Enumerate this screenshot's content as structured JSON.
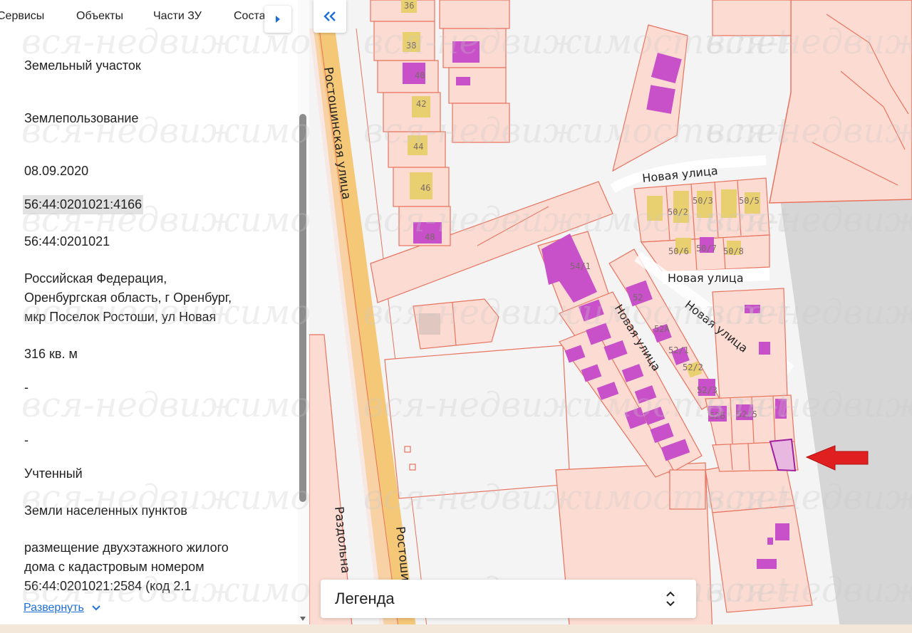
{
  "tabs": [
    "Сервисы",
    "Объекты",
    "Части ЗУ",
    "Соста"
  ],
  "fields": {
    "object_type": "Земельный участок",
    "group": "Землепользование",
    "date": "08.09.2020",
    "cadastral_number": "56:44:0201021:4166",
    "quarter": "56:44:0201021",
    "address_line1": "Российская Федерация,",
    "address_line2": "Оренбургская область, г Оренбург,",
    "address_line3": "мкр Поселок Ростоши, ул Новая",
    "area": "316 кв. м",
    "dash1": "-",
    "dash2": "-",
    "status": "Учтенный",
    "category": "Земли населенных пунктов",
    "use_line1": "размещение двухэтажного жилого",
    "use_line2": "дома с кадастровым номером",
    "use_line3": "56:44:0201021:2584 (код 2.1"
  },
  "expand_label": "Развернуть",
  "legend_label": "Легенда",
  "icons": {
    "tab_nav": "caret-right-icon",
    "collapse": "double-chevron-left-icon",
    "expand": "chevron-down-icon",
    "legend": "up-down-arrows-icon",
    "pointer": "red-arrow-icon"
  },
  "map": {
    "streets": {
      "rostoshinskaya": "Ростошинская улица",
      "rostoshinskaya_bottom": "Ростоши",
      "razdolnaya": "Раздольна",
      "novaya": "Новая улица"
    },
    "house_numbers": [
      "36",
      "38",
      "40",
      "42",
      "44",
      "46",
      "48",
      "54/1",
      "52",
      "52А",
      "52/1",
      "52/2",
      "52/3",
      "52Б",
      "52/5",
      "50/2",
      "50/3",
      "50/5",
      "50/6",
      "50/7",
      "50/8"
    ],
    "watermark": "вся-недвижимость.net"
  },
  "colors": {
    "parcel_fill": "#fcdcd2",
    "parcel_stroke": "#e8735f",
    "building_purple": "#c850c8",
    "building_yellow": "#e8d070",
    "road_main": "#f5c878",
    "link": "#1e6fd9",
    "arrow": "#e02020"
  }
}
